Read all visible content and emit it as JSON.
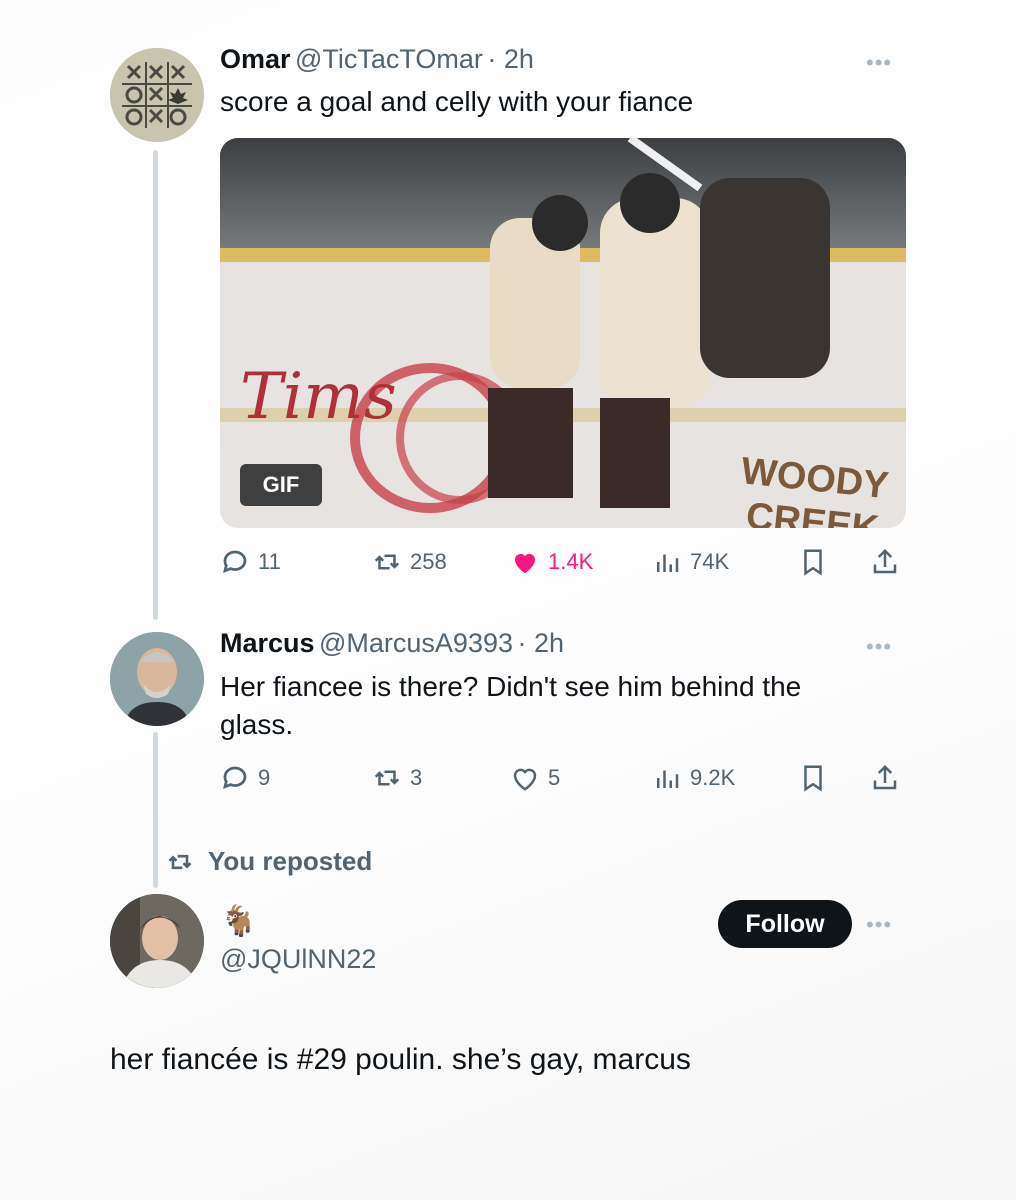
{
  "tweets": [
    {
      "name": "Omar",
      "handle": "@TicTacTOmar",
      "time": "· 2h",
      "text": "score a goal and celly with your fiance",
      "media_badge": "GIF",
      "media_text": [
        "Tims",
        "WOODY",
        "CREEK"
      ],
      "stats": {
        "replies": "11",
        "reposts": "258",
        "likes": "1.4K",
        "views": "74K"
      }
    },
    {
      "name": "Marcus",
      "handle": "@MarcusA9393",
      "time": "· 2h",
      "text_line1": "Her fiancee is there? Didn't see him behind the",
      "text_line2": "glass.",
      "stats": {
        "replies": "9",
        "reposts": "3",
        "likes": "5",
        "views": "9.2K"
      }
    }
  ],
  "repost_banner": "You reposted",
  "reply": {
    "display_name_emoji": "🐐",
    "handle": "@JQUlNN22",
    "follow_label": "Follow",
    "text": "her fiancée is #29 poulin. she’s gay, marcus"
  },
  "more_label": "•••",
  "colors": {
    "like": "#f91880",
    "muted": "#536471",
    "follow_bg": "#0f1419"
  },
  "icons": [
    "reply-icon",
    "repost-icon",
    "like-icon",
    "views-icon",
    "bookmark-icon",
    "share-icon",
    "more-icon"
  ]
}
